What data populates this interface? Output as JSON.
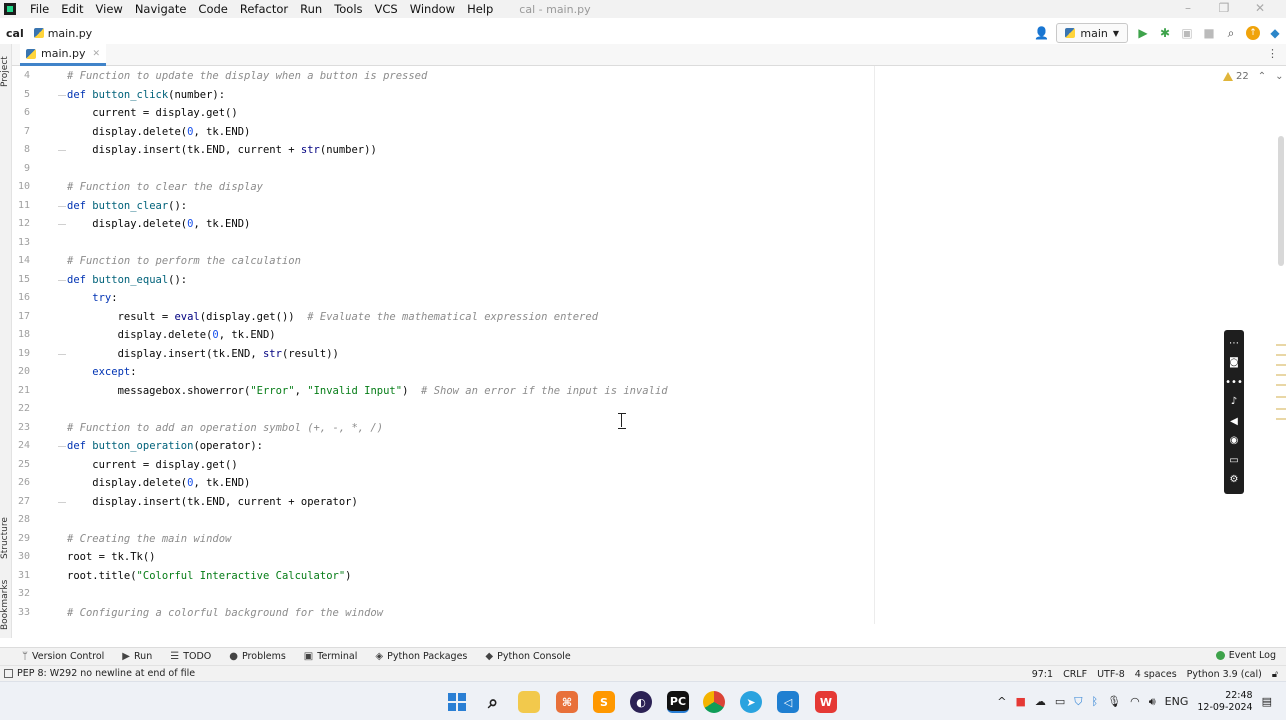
{
  "menubar": {
    "items": [
      "File",
      "Edit",
      "View",
      "Navigate",
      "Code",
      "Refactor",
      "Run",
      "Tools",
      "VCS",
      "Window",
      "Help"
    ],
    "window_title": "cal - main.py"
  },
  "navbar": {
    "project": "cal",
    "file": "main.py",
    "run_config": "main"
  },
  "left_strip": {
    "project_label": "Project",
    "structure_label": "Structure",
    "bookmarks_label": "Bookmarks"
  },
  "editor": {
    "tab_label": "main.py",
    "inspection_count": "22",
    "line_numbers": [
      "4",
      "5",
      "6",
      "7",
      "8",
      "9",
      "10",
      "11",
      "12",
      "13",
      "14",
      "15",
      "16",
      "17",
      "18",
      "19",
      "20",
      "21",
      "22",
      "23",
      "24",
      "25",
      "26",
      "27",
      "28",
      "29",
      "30",
      "31",
      "32",
      "33"
    ],
    "code": {
      "l4_comment": "# Function to update the display when a button is pressed",
      "l5_kw": "def ",
      "l5_fn": "button_click",
      "l5_rest": "(number):",
      "l6": "    current = display.get()",
      "l7_a": "    display.delete(",
      "l7_num": "0",
      "l7_b": ", tk.END)",
      "l8_a": "    display.insert(tk.END, current + ",
      "l8_bi": "str",
      "l8_b": "(number))",
      "l10_comment": "# Function to clear the display",
      "l11_kw": "def ",
      "l11_fn": "button_clear",
      "l11_rest": "():",
      "l12_a": "    display.delete(",
      "l12_num": "0",
      "l12_b": ", tk.END)",
      "l14_comment": "# Function to perform the calculation",
      "l15_kw": "def ",
      "l15_fn": "button_equal",
      "l15_rest": "():",
      "l16_kw": "    try",
      "l16_rest": ":",
      "l17_a": "        result = ",
      "l17_bi": "eval",
      "l17_b": "(display.get())  ",
      "l17_comment": "# Evaluate the mathematical expression entered",
      "l18_a": "        display.delete(",
      "l18_num": "0",
      "l18_b": ", tk.END)",
      "l19_a": "        display.insert(tk.END, ",
      "l19_bi": "str",
      "l19_b": "(result))",
      "l20_kw": "    except",
      "l20_rest": ":",
      "l21_a": "        messagebox.showerror(",
      "l21_s1": "\"Error\"",
      "l21_sep": ", ",
      "l21_s2": "\"Invalid Input\"",
      "l21_b": ")  ",
      "l21_comment": "# Show an error if the input is invalid",
      "l23_comment": "# Function to add an operation symbol (+, -, *, /)",
      "l24_kw": "def ",
      "l24_fn": "button_operation",
      "l24_rest": "(operator):",
      "l25": "    current = display.get()",
      "l26_a": "    display.delete(",
      "l26_num": "0",
      "l26_b": ", tk.END)",
      "l27": "    display.insert(tk.END, current + operator)",
      "l29_comment": "# Creating the main window",
      "l30": "root = tk.Tk()",
      "l31_a": "root.title(",
      "l31_s": "\"Colorful Interactive Calculator\"",
      "l31_b": ")",
      "l33_comment": "# Configuring a colorful background for the window"
    }
  },
  "tool_windows": [
    "Version Control",
    "Run",
    "TODO",
    "Problems",
    "Terminal",
    "Python Packages",
    "Python Console"
  ],
  "event_log": "Event Log",
  "status": {
    "message": "PEP 8: W292 no newline at end of file",
    "position": "97:1",
    "line_sep": "CRLF",
    "encoding": "UTF-8",
    "indent": "4 spaces",
    "interpreter": "Python 3.9 (cal)"
  },
  "taskbar": {
    "lang": "ENG",
    "time": "22:48",
    "date": "12-09-2024"
  },
  "colors": {
    "keyword": "#0033b3",
    "function": "#00627a",
    "comment": "#8c8c8c",
    "string": "#067d17",
    "number": "#1750eb"
  }
}
